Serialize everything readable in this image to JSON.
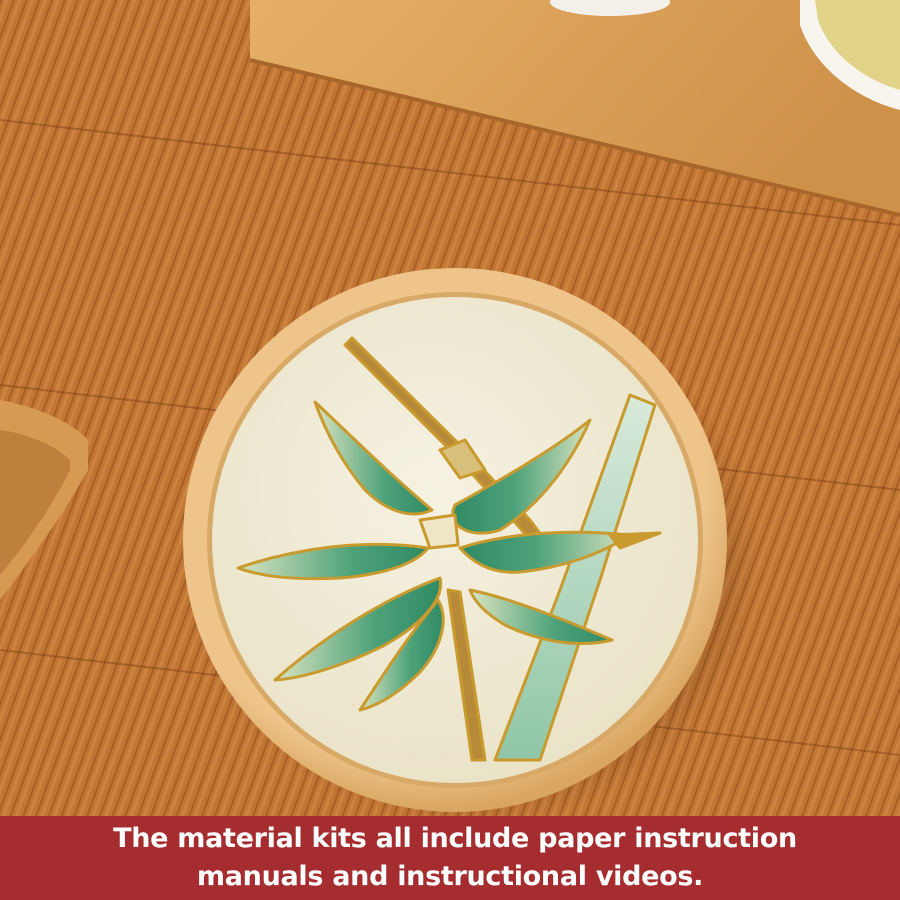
{
  "caption": {
    "line1": "The material kits all include paper instruction",
    "line2": "manuals and instructional videos."
  },
  "colors": {
    "banner": "#a52d2f",
    "bamboo_mat": "#c57a35",
    "coaster_rim": "#e3b778",
    "coaster_face": "#f1ecd8",
    "leaf_green": "#3f9a73",
    "gold_outline": "#c99a2e"
  },
  "scene": {
    "subject": "bamboo-painting-coaster",
    "background": "bamboo-mat-tray"
  }
}
